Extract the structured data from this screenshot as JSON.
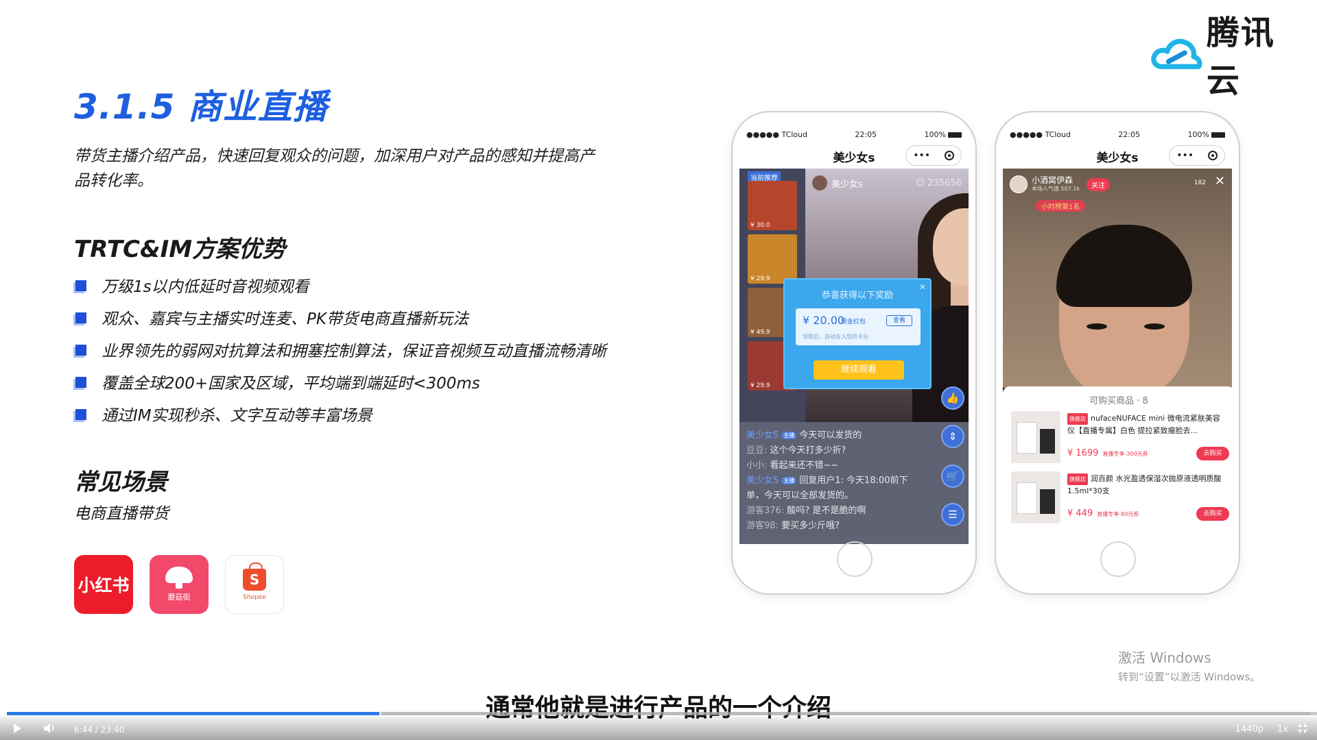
{
  "brand": {
    "logo_text": "腾讯云",
    "cloud_color": "#21b4e8"
  },
  "slide": {
    "title": "3.1.5 商业直播",
    "intro": "带货主播介绍产品，快速回复观众的问题，加深用户对产品的感知并提高产品转化率。",
    "advantages_heading": "TRTC&IM方案优势",
    "advantages": [
      "万级1s以内低延时音视频观看",
      "观众、嘉宾与主播实时连麦、PK带货电商直播新玩法",
      "业界领先的弱网对抗算法和拥塞控制算法，保证音视频互动直播流畅清晰",
      "覆盖全球200+国家及区域，平均端到端延时<300ms",
      "通过IM实现秒杀、文字互动等丰富场景"
    ],
    "scene_heading": "常见场景",
    "scene_sub": "电商直播带货",
    "apps": {
      "xhs": "小红书",
      "mgj": "蘑菇街",
      "shopee": "Shopee",
      "shopee_letter": "S"
    }
  },
  "phone1": {
    "carrier": "●●●●● TCloud",
    "time": "22:05",
    "battery": "100%",
    "nav_title": "美少女s",
    "capsule_dots": "•••",
    "sidebar_badge": "当前推荐",
    "thumbs": [
      "¥ 30.0",
      "¥ 29.9",
      "¥ 49.9",
      "¥ 29.9"
    ],
    "host_name": "美少女s",
    "viewers": "235656",
    "dialog_title": "恭喜获得以下奖励",
    "dialog_close": "✕",
    "coupon_amount": "¥ 20.00",
    "coupon_tag": "现金红包",
    "coupon_view": "查看",
    "coupon_note": "领取后，自动存入您的卡包",
    "continue_label": "继续观看",
    "chat": [
      {
        "name": "美少女S",
        "level": "主播",
        "text": "今天可以发货的"
      },
      {
        "name": "豆豆:",
        "level": "",
        "text": "这个今天打多少折?"
      },
      {
        "name": "小小:",
        "level": "",
        "text": "看起来还不错~~"
      },
      {
        "name": "美少女S",
        "level": "主播",
        "text": "回复用户1: 今天18:00前下"
      },
      {
        "name": "",
        "level": "",
        "text": "单，今天可以全部发货的。"
      },
      {
        "name": "游客376:",
        "level": "",
        "text": "酸吗? 是不是脆的啊"
      },
      {
        "name": "游客98:",
        "level": "",
        "text": "要买多少斤哦?"
      }
    ]
  },
  "phone2": {
    "carrier": "●●●●● TCloud",
    "time": "22:05",
    "battery": "100%",
    "nav_title": "美少女s",
    "capsule_dots": "•••",
    "host_name": "小酒窝伊森",
    "host_sub": "本场人气值 507.1k",
    "follow": "关注",
    "viewers": "182",
    "close": "✕",
    "rank": "小时榜第1名",
    "sheet_title": "可购买商品 · 8",
    "items": [
      {
        "flag": "旗舰店",
        "name": "nufaceNUFACE mini 微电流紧肤美容仪【直播专属】白色 提拉紧致瘦脸去...",
        "price": "¥ 1699",
        "discount": "直播专享-300元券",
        "buy": "去购买"
      },
      {
        "flag": "旗舰店",
        "name": "润百颜 水光盈透保湿次抛原液透明质酸 1.5ml*30支",
        "price": "¥ 449",
        "discount": "直播专享-80元券",
        "buy": "去购买"
      }
    ]
  },
  "watermark": {
    "line1": "激活 Windows",
    "line2": "转到“设置”以激活 Windows。"
  },
  "caption": "通常他就是进行产品的一个介绍",
  "player": {
    "time": "6:44 / 23:40",
    "quality": "1440p",
    "speed": "1x",
    "progress": 0.286,
    "accent": "#2e7be6"
  }
}
